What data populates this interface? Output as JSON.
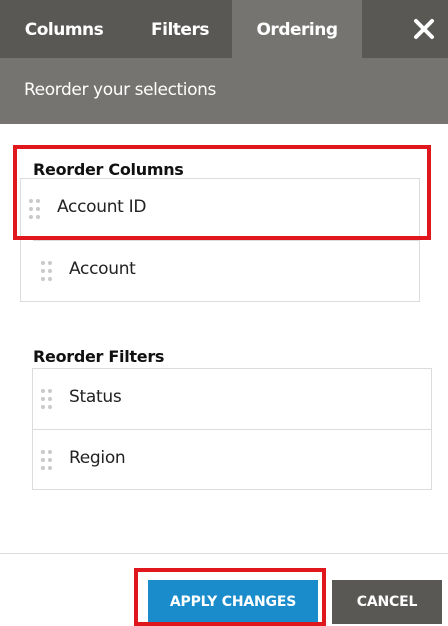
{
  "tabs": [
    {
      "label": "Columns",
      "active": false
    },
    {
      "label": "Filters",
      "active": false
    },
    {
      "label": "Ordering",
      "active": true
    }
  ],
  "close_icon": "close-icon",
  "subheader": "Reorder your selections",
  "reorder_columns": {
    "title": "Reorder Columns",
    "items": [
      "Account ID",
      "Account"
    ]
  },
  "reorder_filters": {
    "title": "Reorder Filters",
    "items": [
      "Status",
      "Region"
    ]
  },
  "footer": {
    "apply_label": "APPLY CHANGES",
    "cancel_label": "CANCEL"
  },
  "colors": {
    "tab_bar": "#595855",
    "active_tab": "#757470",
    "apply": "#1a8ccc",
    "cancel": "#595855",
    "highlight": "#e0181d"
  }
}
